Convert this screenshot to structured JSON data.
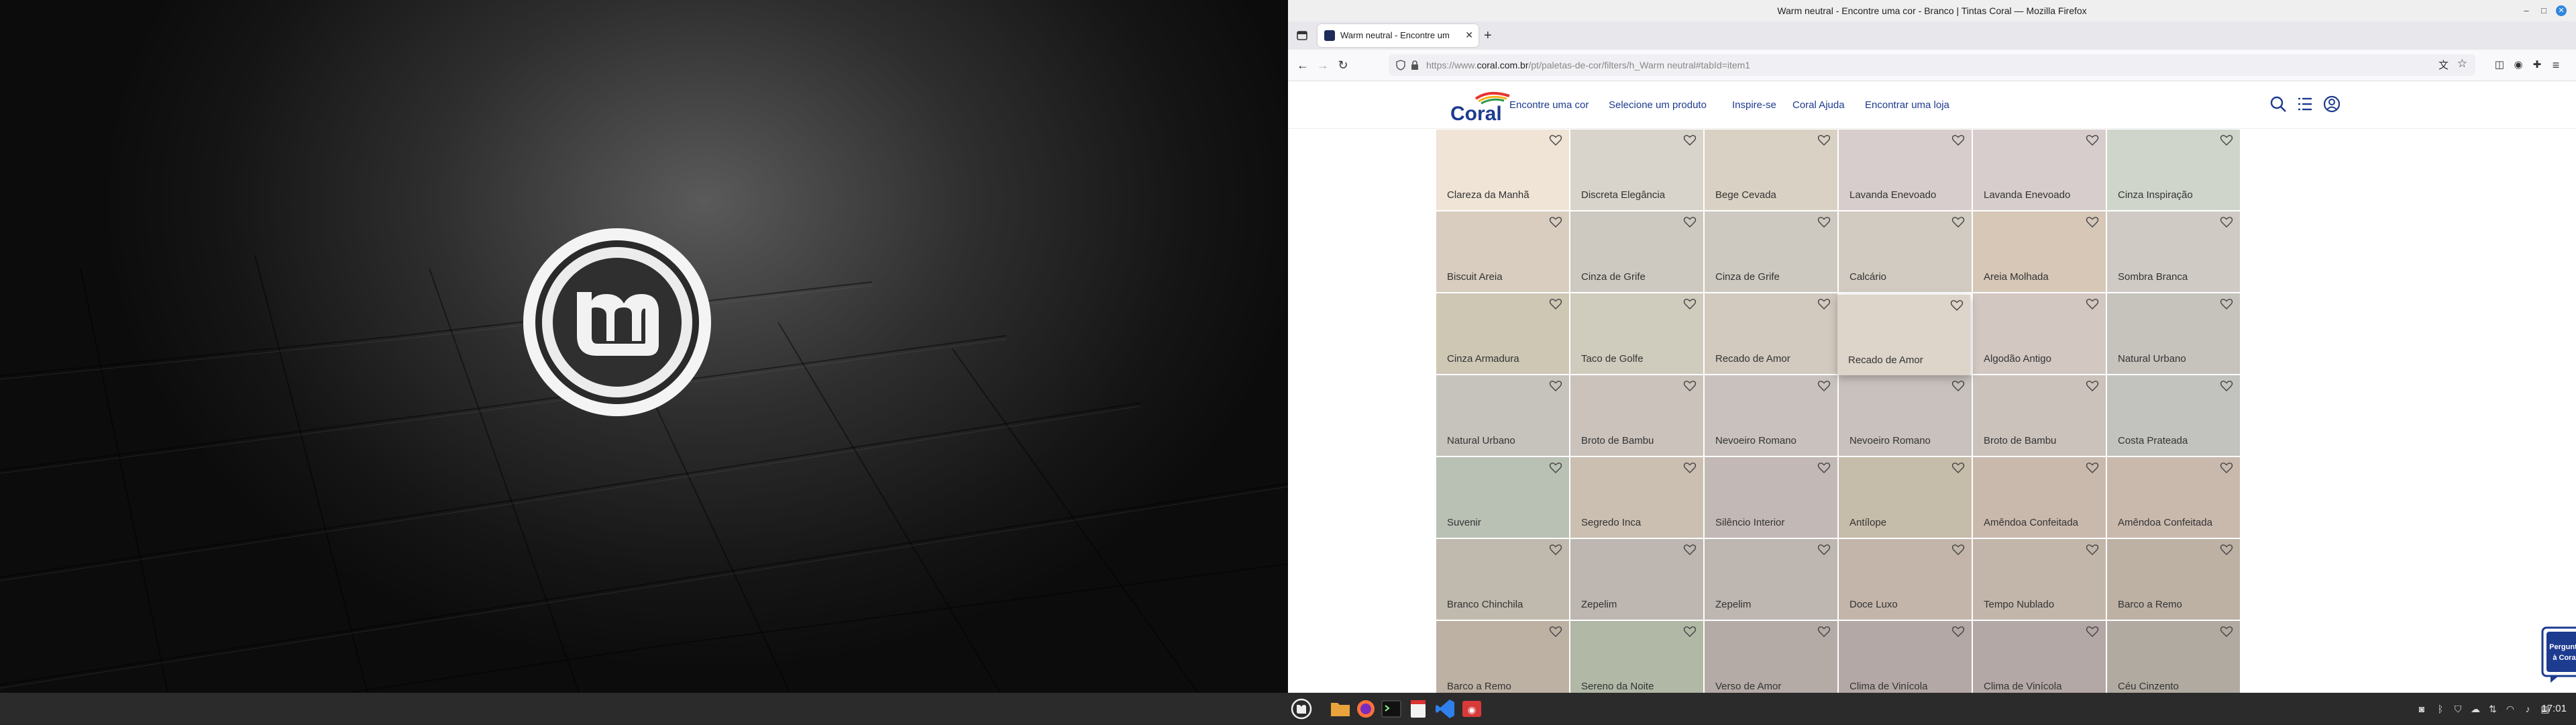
{
  "window": {
    "title": "Warm neutral - Encontre uma cor - Branco | Tintas Coral — Mozilla Firefox"
  },
  "tab": {
    "title": "Warm neutral - Encontre um",
    "new_tab": "+"
  },
  "url": {
    "prefix": "https://www.",
    "domain": "coral.com.br",
    "path": "/pt/paletas-de-cor/filters/h_Warm neutral#tabId=item1"
  },
  "site": {
    "logo": "Coral",
    "menu": [
      "Encontre uma cor",
      "Selecione um produto",
      "Inspire-se",
      "Coral Ajuda",
      "Encontrar uma loja"
    ],
    "help_widget": [
      "Pergunte",
      "à Coral"
    ]
  },
  "swatches": [
    [
      {
        "name": "Clareza da Manhã",
        "color": "#efe4d6"
      },
      {
        "name": "Discreta Elegância",
        "color": "#d8d3cb"
      },
      {
        "name": "Bege Cevada",
        "color": "#d9d1c3"
      },
      {
        "name": "Lavanda Enevoado",
        "color": "#d6cdcc"
      },
      {
        "name": "Lavanda Enevoado",
        "color": "#d6cdcc"
      },
      {
        "name": "Cinza Inspiração",
        "color": "#cfd5ca"
      }
    ],
    [
      {
        "name": "Biscuit Areia",
        "color": "#d8cdbf"
      },
      {
        "name": "Cinza de Grife",
        "color": "#cdc9c0"
      },
      {
        "name": "Cinza de Grife",
        "color": "#cdc9c0"
      },
      {
        "name": "Calcário",
        "color": "#d2cbc1"
      },
      {
        "name": "Areia Molhada",
        "color": "#d6c7b7"
      },
      {
        "name": "Sombra Branca",
        "color": "#cfcbc4"
      }
    ],
    [
      {
        "name": "Cinza Armadura",
        "color": "#cdc7b4"
      },
      {
        "name": "Taco de Golfe",
        "color": "#cfcbbd"
      },
      {
        "name": "Recado de Amor",
        "color": "#d2c9bf"
      },
      {
        "name": "Recado de Amor",
        "color": "#ddd4ca"
      },
      {
        "name": "Algodão Antigo",
        "color": "#d3c7c1"
      },
      {
        "name": "Natural Urbano",
        "color": "#c6c3bd"
      }
    ],
    [
      {
        "name": "Natural Urbano",
        "color": "#c6c3bd"
      },
      {
        "name": "Broto de Bambu",
        "color": "#cbc2bb"
      },
      {
        "name": "Nevoeiro Romano",
        "color": "#c8c1bd"
      },
      {
        "name": "Nevoeiro Romano",
        "color": "#c8c1bd"
      },
      {
        "name": "Broto de Bambu",
        "color": "#cbc2bb"
      },
      {
        "name": "Costa Prateada",
        "color": "#c2c3bf"
      }
    ],
    [
      {
        "name": "Suvenir",
        "color": "#b9c0b4"
      },
      {
        "name": "Segredo Inca",
        "color": "#cbbfb2"
      },
      {
        "name": "Silêncio Interior",
        "color": "#c2b8b5"
      },
      {
        "name": "Antílope",
        "color": "#c6bcaa"
      },
      {
        "name": "Amêndoa Confeitada",
        "color": "#c9b9ad"
      },
      {
        "name": "Amêndoa Confeitada",
        "color": "#c9b9ad"
      }
    ],
    [
      {
        "name": "Branco Chinchila",
        "color": "#c0b9ad"
      },
      {
        "name": "Zepelim",
        "color": "#bdb6b1"
      },
      {
        "name": "Zepelim",
        "color": "#bdb6b1"
      },
      {
        "name": "Doce Luxo",
        "color": "#c3b5a9"
      },
      {
        "name": "Tempo Nublado",
        "color": "#c2b6ab"
      },
      {
        "name": "Barco a Remo",
        "color": "#bdb1a4"
      }
    ],
    [
      {
        "name": "Barco a Remo",
        "color": "#bdb1a4"
      },
      {
        "name": "Sereno da Noite",
        "color": "#b1b8a6"
      },
      {
        "name": "Verso de Amor",
        "color": "#b4aba6"
      },
      {
        "name": "Clima de Vinícola",
        "color": "#b3a8a6"
      },
      {
        "name": "Clima de Vinícola",
        "color": "#b3a8a6"
      },
      {
        "name": "Céu Cinzento",
        "color": "#b0aaa1"
      }
    ]
  ],
  "taskbar": {
    "clock": "17:01"
  }
}
